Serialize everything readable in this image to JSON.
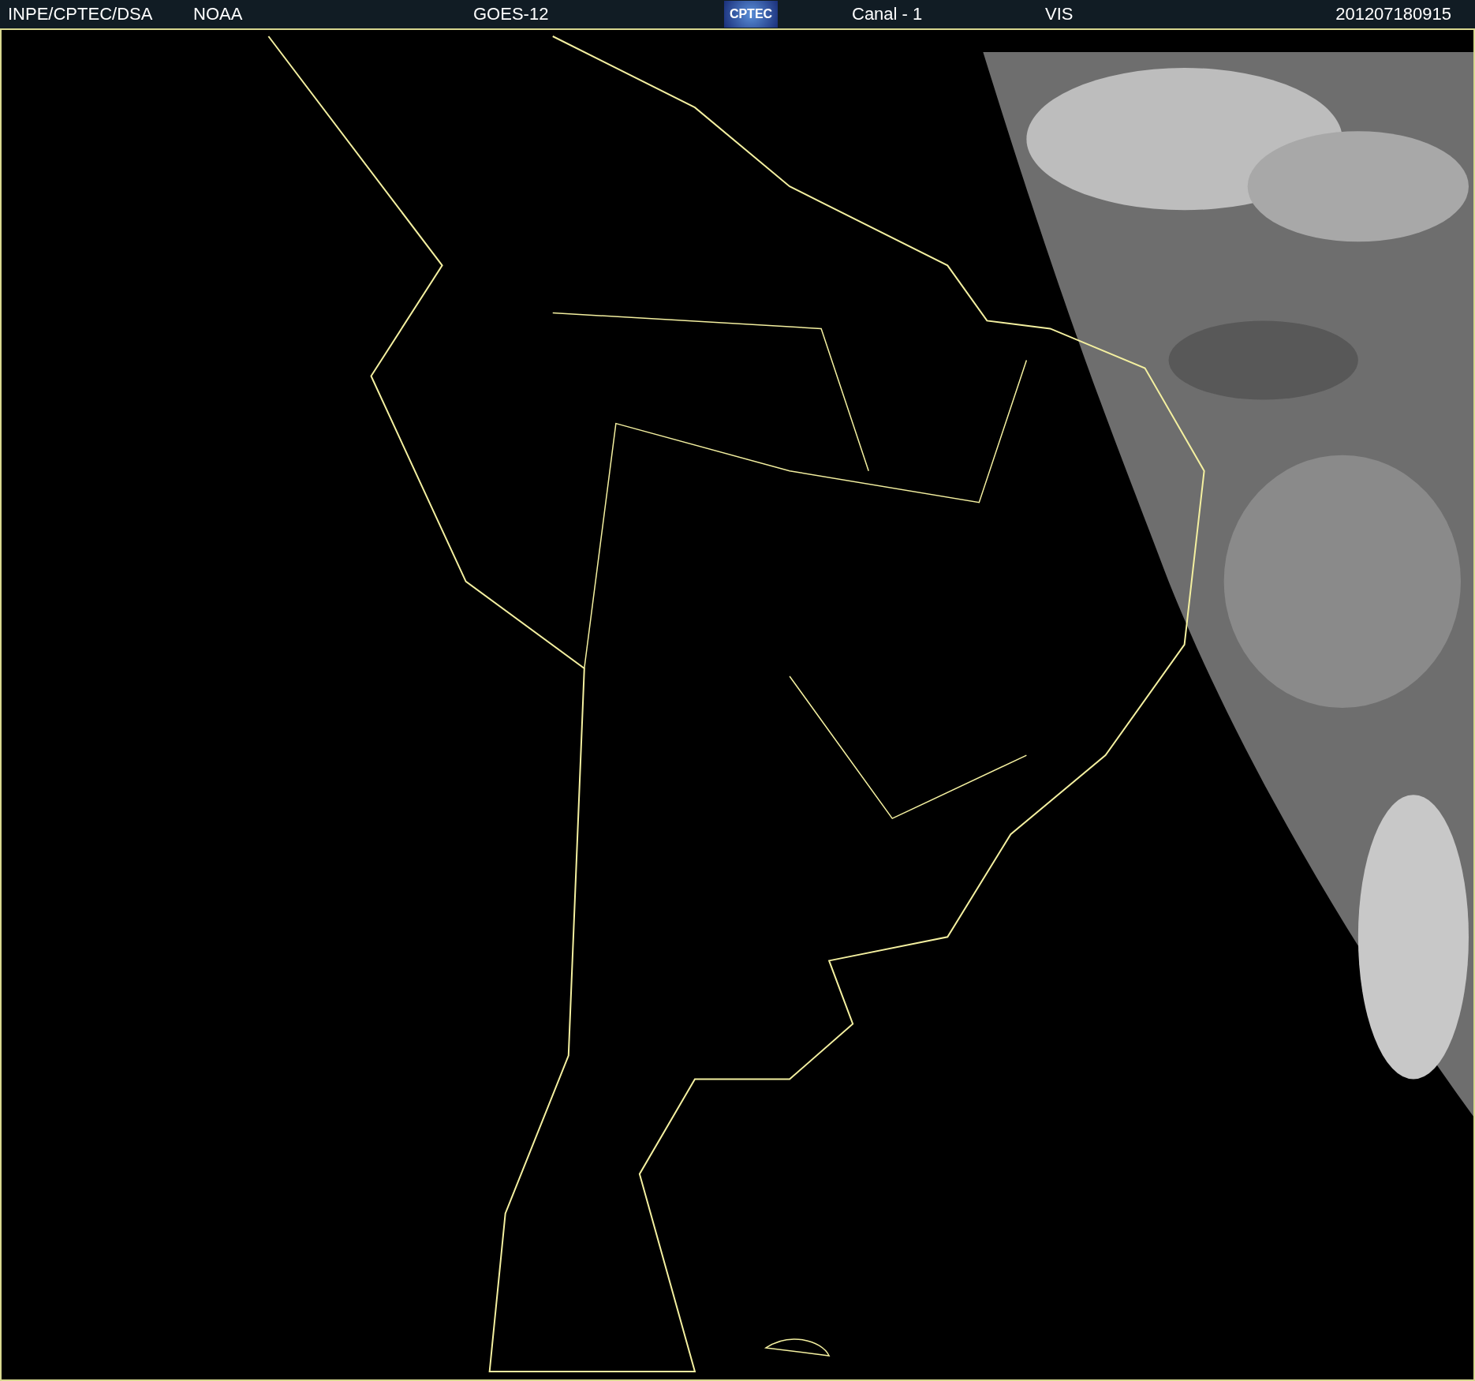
{
  "header": {
    "institution": "INPE/CPTEC/DSA",
    "agency": "NOAA",
    "satellite": "GOES-12",
    "logo": "CPTEC",
    "channel": "Canal - 1",
    "band": "VIS",
    "timestamp": "201207180915"
  }
}
